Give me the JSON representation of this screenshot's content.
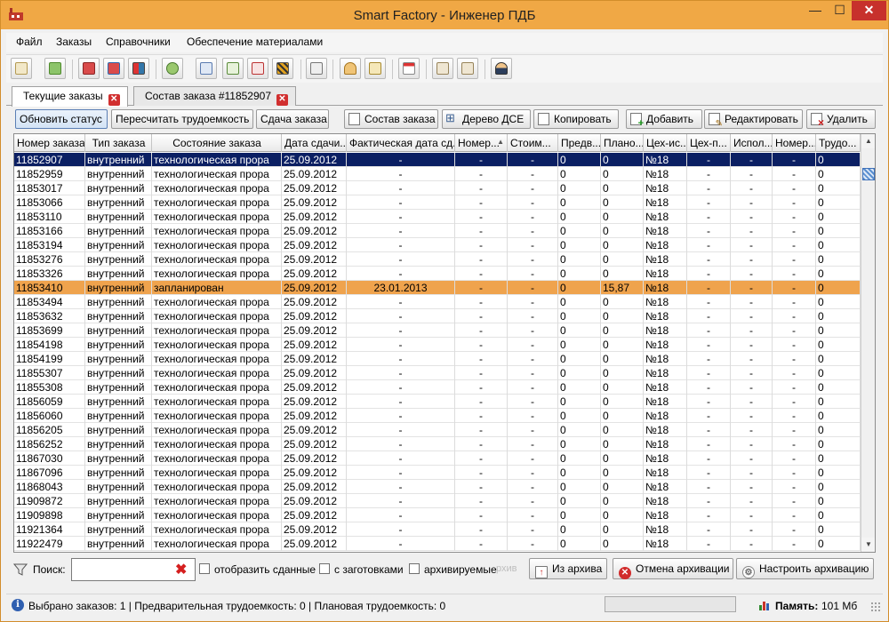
{
  "window": {
    "title": "Smart Factory - Инженер ПДБ",
    "min_glyph": "—",
    "max_glyph": "☐",
    "close_glyph": "✕"
  },
  "menu": [
    "Файл",
    "Заказы",
    "Справочники",
    "Обеспечение материалами"
  ],
  "toolbar_icons": [
    "new-document-icon",
    "refresh-icon",
    "report-icon-1",
    "report-icon-2",
    "report-icon-3",
    "redo-icon",
    "tree-icon-1",
    "tree-icon-2",
    "route-icon",
    "barrier-icon",
    "calculator-icon",
    "user-icon",
    "documents-icon",
    "calendar-icon",
    "card-icon-1",
    "card-icon-2",
    "engineer-icon"
  ],
  "tabs": [
    {
      "label": "Текущие заказы",
      "active": true
    },
    {
      "label": "Состав заказа #11852907",
      "active": false
    }
  ],
  "actions": {
    "refresh_status": "Обновить статус",
    "recalc": "Пересчитать трудоемкость",
    "deliver": "Сдача заказа",
    "composition": "Состав заказа",
    "dse_tree": "Дерево ДСЕ",
    "copy": "Копировать",
    "add": "Добавить",
    "edit": "Редактировать",
    "delete": "Удалить"
  },
  "columns": [
    "Номер заказа",
    "Тип заказа",
    "Состояние заказа",
    "Дата сдачи...",
    "Фактическая дата сд...",
    "Номер...",
    "Стоим...",
    "Предв...",
    "Плано...",
    "Цех-ис...",
    "Цех-п...",
    "Испол...",
    "Номер...",
    "Трудо..."
  ],
  "rows": [
    {
      "num": "11852907",
      "type": "внутренний",
      "state": "технологическая прора",
      "date": "25.09.2012",
      "fact": "-",
      "n2": "-",
      "cost": "-",
      "pred": "0",
      "plan": "0",
      "shop": "№18",
      "shop2": "-",
      "exec": "-",
      "n3": "-",
      "labor": "0",
      "status": "selected"
    },
    {
      "num": "11852959",
      "type": "внутренний",
      "state": "технологическая прора",
      "date": "25.09.2012",
      "fact": "-",
      "n2": "-",
      "cost": "-",
      "pred": "0",
      "plan": "0",
      "shop": "№18",
      "shop2": "-",
      "exec": "-",
      "n3": "-",
      "labor": "0",
      "status": "normal"
    },
    {
      "num": "11853017",
      "type": "внутренний",
      "state": "технологическая прора",
      "date": "25.09.2012",
      "fact": "-",
      "n2": "-",
      "cost": "-",
      "pred": "0",
      "plan": "0",
      "shop": "№18",
      "shop2": "-",
      "exec": "-",
      "n3": "-",
      "labor": "0",
      "status": "normal"
    },
    {
      "num": "11853066",
      "type": "внутренний",
      "state": "технологическая прора",
      "date": "25.09.2012",
      "fact": "-",
      "n2": "-",
      "cost": "-",
      "pred": "0",
      "plan": "0",
      "shop": "№18",
      "shop2": "-",
      "exec": "-",
      "n3": "-",
      "labor": "0",
      "status": "normal"
    },
    {
      "num": "11853110",
      "type": "внутренний",
      "state": "технологическая прора",
      "date": "25.09.2012",
      "fact": "-",
      "n2": "-",
      "cost": "-",
      "pred": "0",
      "plan": "0",
      "shop": "№18",
      "shop2": "-",
      "exec": "-",
      "n3": "-",
      "labor": "0",
      "status": "normal"
    },
    {
      "num": "11853166",
      "type": "внутренний",
      "state": "технологическая прора",
      "date": "25.09.2012",
      "fact": "-",
      "n2": "-",
      "cost": "-",
      "pred": "0",
      "plan": "0",
      "shop": "№18",
      "shop2": "-",
      "exec": "-",
      "n3": "-",
      "labor": "0",
      "status": "normal"
    },
    {
      "num": "11853194",
      "type": "внутренний",
      "state": "технологическая прора",
      "date": "25.09.2012",
      "fact": "-",
      "n2": "-",
      "cost": "-",
      "pred": "0",
      "plan": "0",
      "shop": "№18",
      "shop2": "-",
      "exec": "-",
      "n3": "-",
      "labor": "0",
      "status": "normal"
    },
    {
      "num": "11853276",
      "type": "внутренний",
      "state": "технологическая прора",
      "date": "25.09.2012",
      "fact": "-",
      "n2": "-",
      "cost": "-",
      "pred": "0",
      "plan": "0",
      "shop": "№18",
      "shop2": "-",
      "exec": "-",
      "n3": "-",
      "labor": "0",
      "status": "normal"
    },
    {
      "num": "11853326",
      "type": "внутренний",
      "state": "технологическая прора",
      "date": "25.09.2012",
      "fact": "-",
      "n2": "-",
      "cost": "-",
      "pred": "0",
      "plan": "0",
      "shop": "№18",
      "shop2": "-",
      "exec": "-",
      "n3": "-",
      "labor": "0",
      "status": "normal"
    },
    {
      "num": "11853410",
      "type": "внутренний",
      "state": "запланирован",
      "date": "25.09.2012",
      "fact": "23.01.2013",
      "n2": "-",
      "cost": "-",
      "pred": "0",
      "plan": "15,87",
      "shop": "№18",
      "shop2": "-",
      "exec": "-",
      "n3": "-",
      "labor": "0",
      "status": "highlight"
    },
    {
      "num": "11853494",
      "type": "внутренний",
      "state": "технологическая прора",
      "date": "25.09.2012",
      "fact": "-",
      "n2": "-",
      "cost": "-",
      "pred": "0",
      "plan": "0",
      "shop": "№18",
      "shop2": "-",
      "exec": "-",
      "n3": "-",
      "labor": "0",
      "status": "normal"
    },
    {
      "num": "11853632",
      "type": "внутренний",
      "state": "технологическая прора",
      "date": "25.09.2012",
      "fact": "-",
      "n2": "-",
      "cost": "-",
      "pred": "0",
      "plan": "0",
      "shop": "№18",
      "shop2": "-",
      "exec": "-",
      "n3": "-",
      "labor": "0",
      "status": "normal"
    },
    {
      "num": "11853699",
      "type": "внутренний",
      "state": "технологическая прора",
      "date": "25.09.2012",
      "fact": "-",
      "n2": "-",
      "cost": "-",
      "pred": "0",
      "plan": "0",
      "shop": "№18",
      "shop2": "-",
      "exec": "-",
      "n3": "-",
      "labor": "0",
      "status": "normal"
    },
    {
      "num": "11854198",
      "type": "внутренний",
      "state": "технологическая прора",
      "date": "25.09.2012",
      "fact": "-",
      "n2": "-",
      "cost": "-",
      "pred": "0",
      "plan": "0",
      "shop": "№18",
      "shop2": "-",
      "exec": "-",
      "n3": "-",
      "labor": "0",
      "status": "normal"
    },
    {
      "num": "11854199",
      "type": "внутренний",
      "state": "технологическая прора",
      "date": "25.09.2012",
      "fact": "-",
      "n2": "-",
      "cost": "-",
      "pred": "0",
      "plan": "0",
      "shop": "№18",
      "shop2": "-",
      "exec": "-",
      "n3": "-",
      "labor": "0",
      "status": "normal"
    },
    {
      "num": "11855307",
      "type": "внутренний",
      "state": "технологическая прора",
      "date": "25.09.2012",
      "fact": "-",
      "n2": "-",
      "cost": "-",
      "pred": "0",
      "plan": "0",
      "shop": "№18",
      "shop2": "-",
      "exec": "-",
      "n3": "-",
      "labor": "0",
      "status": "normal"
    },
    {
      "num": "11855308",
      "type": "внутренний",
      "state": "технологическая прора",
      "date": "25.09.2012",
      "fact": "-",
      "n2": "-",
      "cost": "-",
      "pred": "0",
      "plan": "0",
      "shop": "№18",
      "shop2": "-",
      "exec": "-",
      "n3": "-",
      "labor": "0",
      "status": "normal"
    },
    {
      "num": "11856059",
      "type": "внутренний",
      "state": "технологическая прора",
      "date": "25.09.2012",
      "fact": "-",
      "n2": "-",
      "cost": "-",
      "pred": "0",
      "plan": "0",
      "shop": "№18",
      "shop2": "-",
      "exec": "-",
      "n3": "-",
      "labor": "0",
      "status": "normal"
    },
    {
      "num": "11856060",
      "type": "внутренний",
      "state": "технологическая прора",
      "date": "25.09.2012",
      "fact": "-",
      "n2": "-",
      "cost": "-",
      "pred": "0",
      "plan": "0",
      "shop": "№18",
      "shop2": "-",
      "exec": "-",
      "n3": "-",
      "labor": "0",
      "status": "normal"
    },
    {
      "num": "11856205",
      "type": "внутренний",
      "state": "технологическая прора",
      "date": "25.09.2012",
      "fact": "-",
      "n2": "-",
      "cost": "-",
      "pred": "0",
      "plan": "0",
      "shop": "№18",
      "shop2": "-",
      "exec": "-",
      "n3": "-",
      "labor": "0",
      "status": "normal"
    },
    {
      "num": "11856252",
      "type": "внутренний",
      "state": "технологическая прора",
      "date": "25.09.2012",
      "fact": "-",
      "n2": "-",
      "cost": "-",
      "pred": "0",
      "plan": "0",
      "shop": "№18",
      "shop2": "-",
      "exec": "-",
      "n3": "-",
      "labor": "0",
      "status": "normal"
    },
    {
      "num": "11867030",
      "type": "внутренний",
      "state": "технологическая прора",
      "date": "25.09.2012",
      "fact": "-",
      "n2": "-",
      "cost": "-",
      "pred": "0",
      "plan": "0",
      "shop": "№18",
      "shop2": "-",
      "exec": "-",
      "n3": "-",
      "labor": "0",
      "status": "normal"
    },
    {
      "num": "11867096",
      "type": "внутренний",
      "state": "технологическая прора",
      "date": "25.09.2012",
      "fact": "-",
      "n2": "-",
      "cost": "-",
      "pred": "0",
      "plan": "0",
      "shop": "№18",
      "shop2": "-",
      "exec": "-",
      "n3": "-",
      "labor": "0",
      "status": "normal"
    },
    {
      "num": "11868043",
      "type": "внутренний",
      "state": "технологическая прора",
      "date": "25.09.2012",
      "fact": "-",
      "n2": "-",
      "cost": "-",
      "pred": "0",
      "plan": "0",
      "shop": "№18",
      "shop2": "-",
      "exec": "-",
      "n3": "-",
      "labor": "0",
      "status": "normal"
    },
    {
      "num": "11909872",
      "type": "внутренний",
      "state": "технологическая прора",
      "date": "25.09.2012",
      "fact": "-",
      "n2": "-",
      "cost": "-",
      "pred": "0",
      "plan": "0",
      "shop": "№18",
      "shop2": "-",
      "exec": "-",
      "n3": "-",
      "labor": "0",
      "status": "normal"
    },
    {
      "num": "11909898",
      "type": "внутренний",
      "state": "технологическая прора",
      "date": "25.09.2012",
      "fact": "-",
      "n2": "-",
      "cost": "-",
      "pred": "0",
      "plan": "0",
      "shop": "№18",
      "shop2": "-",
      "exec": "-",
      "n3": "-",
      "labor": "0",
      "status": "normal"
    },
    {
      "num": "11921364",
      "type": "внутренний",
      "state": "технологическая прора",
      "date": "25.09.2012",
      "fact": "-",
      "n2": "-",
      "cost": "-",
      "pred": "0",
      "plan": "0",
      "shop": "№18",
      "shop2": "-",
      "exec": "-",
      "n3": "-",
      "labor": "0",
      "status": "normal"
    },
    {
      "num": "11922479",
      "type": "внутренний",
      "state": "технологическая прора",
      "date": "25.09.2012",
      "fact": "-",
      "n2": "-",
      "cost": "-",
      "pred": "0",
      "plan": "0",
      "shop": "№18",
      "shop2": "-",
      "exec": "-",
      "n3": "-",
      "labor": "0",
      "status": "normal"
    }
  ],
  "search": {
    "label": "Поиск:",
    "value": "",
    "show_delivered": "отобразить сданные",
    "with_blanks": "с заготовками",
    "archived": "архивируемые",
    "archived_truncated": "рхив",
    "from_archive": "Из архива",
    "cancel_archive": "Отмена архивации",
    "configure_archive": "Настроить архивацию"
  },
  "status": {
    "text": "Выбрано заказов: 1 | Предварительная трудоемкость:  0 | Плановая трудоемкость:  0",
    "memory_label": "Память:",
    "memory_value": "101 Мб"
  },
  "colors": {
    "titlebar": "#f0a845",
    "selected_row": "#0b1f63",
    "highlight_row": "#efa34d",
    "close_button": "#c7312c"
  }
}
